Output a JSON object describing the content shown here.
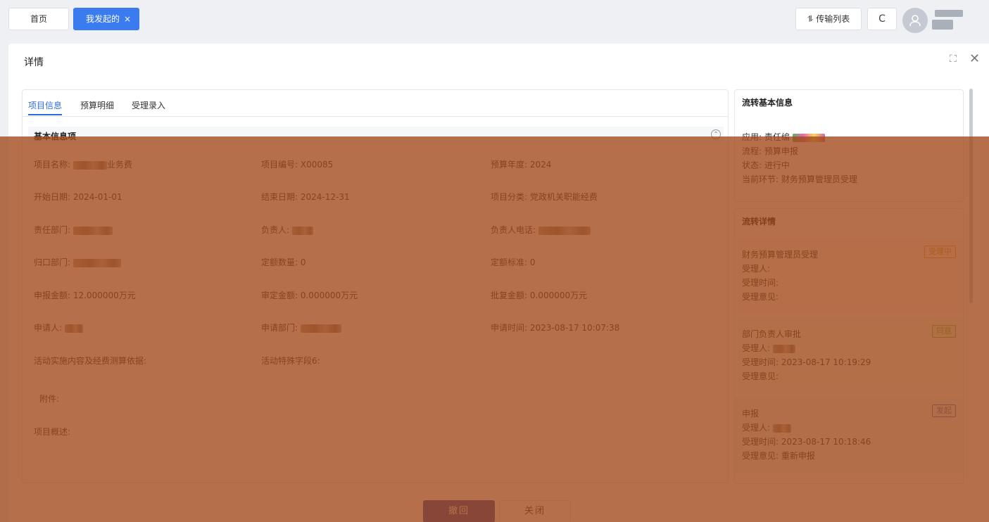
{
  "header": {
    "tabs": [
      {
        "label": "首页"
      },
      {
        "label": "我发起的",
        "close": "×"
      }
    ],
    "transfer_list_label": "⥮ 传输列表",
    "refresh_label": "C"
  },
  "dialog": {
    "title": "详情",
    "maximize_glyph": "⛶",
    "close_glyph": "✕"
  },
  "tabs": [
    {
      "label": "项目信息",
      "active": true
    },
    {
      "label": "预算明细"
    },
    {
      "label": "受理录入"
    }
  ],
  "section": {
    "title": "基本信息项"
  },
  "fields": {
    "project_name_label": "项目名称:",
    "project_name_suffix": "业务费",
    "project_code": "项目编号: X00085",
    "budget_year": "预算年度: 2024",
    "start_date": "开始日期: 2024-01-01",
    "end_date": "结束日期: 2024-12-31",
    "category": "项目分类: 党政机关职能经费",
    "resp_dept_label": "责任部门:",
    "owner_label": "负责人:",
    "owner_phone_label": "负责人电话:",
    "central_dept_label": "归口部门:",
    "quota_qty": "定额数量: 0",
    "quota_std": "定额标准: 0",
    "apply_amount": "申报金额: 12.000000万元",
    "approved_amount": "审定金额: 0.000000万元",
    "granted_amount": "批复金额: 0.000000万元",
    "applicant_label": "申请人:",
    "apply_dept_label": "申请部门:",
    "apply_time": "申请时间: 2023-08-17 10:07:38",
    "activity_basis": "活动实施内容及经费测算依据:",
    "special_field": "活动特殊字段6:",
    "attachment": "附件:",
    "overview": "项目概述:"
  },
  "flow_basic": {
    "title": "流转基本信息",
    "app_label": "应用: 责任编",
    "flow": "流程: 预算申报",
    "status": "状态: 进行中",
    "current_node": "当前环节: 财务预算管理员受理"
  },
  "flow_detail": {
    "title": "流转详情",
    "steps": [
      {
        "name": "财务预算管理员受理",
        "badge": "受理中",
        "handler": "受理人:",
        "time": "受理时间:",
        "opinion": "受理意见:",
        "bg": "#fdf6ec",
        "badge_color": "#e6a23c"
      },
      {
        "name": "部门负责人审批",
        "badge": "同意",
        "handler": "受理人:",
        "time": "受理时间:  2023-08-17 10:19:29",
        "opinion": "受理意见:",
        "bg": "#f4f9ec",
        "badge_color": "#67c23a"
      },
      {
        "name": "申报",
        "badge": "发起",
        "handler": "受理人:",
        "time": "受理时间:  2023-08-17 10:18:46",
        "opinion": "受理意见: 重新申报",
        "bg": "#f2f3f7",
        "badge_color": "#5a6fc0"
      }
    ]
  },
  "footer": {
    "revoke_label": "撤回",
    "close_label": "关闭"
  },
  "colors": {
    "primary": "#3a7bf0",
    "revoke_button": "#2d3fa5",
    "overlay": "#a04818"
  },
  "icons": [
    "user-avatar-icon",
    "transfer-icon",
    "refresh-icon",
    "maximize-icon",
    "close-icon",
    "collapse-icon"
  ]
}
